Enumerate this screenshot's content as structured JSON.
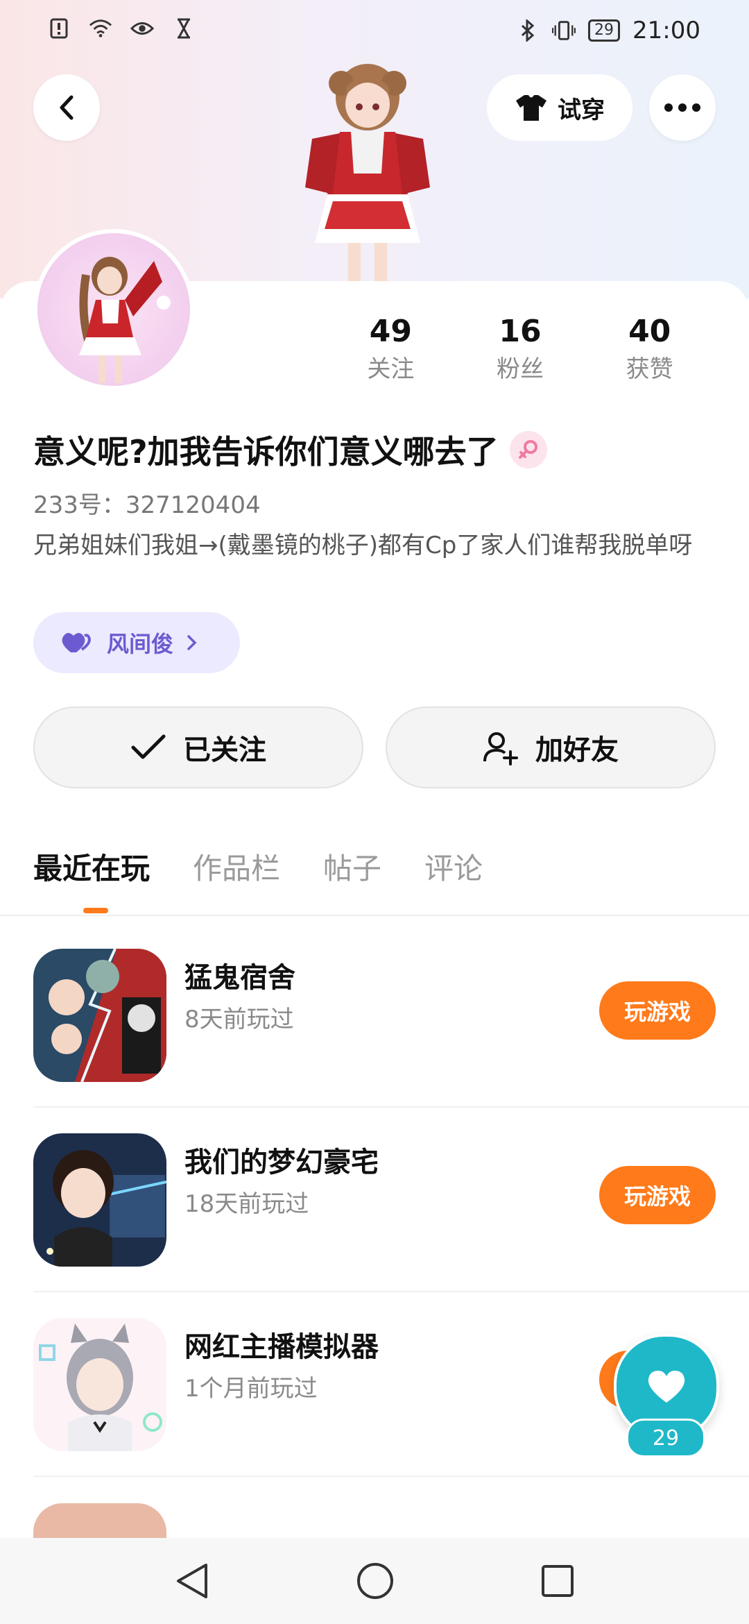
{
  "status_bar": {
    "battery": "29",
    "time": "21:00"
  },
  "header": {
    "back_icon": "chevron-left-icon",
    "try_on_label": "试穿",
    "more_icon": "more-dots-icon"
  },
  "profile": {
    "stats": [
      {
        "value": "49",
        "label": "关注"
      },
      {
        "value": "16",
        "label": "粉丝"
      },
      {
        "value": "40",
        "label": "获赞"
      }
    ],
    "username": "意义呢?加我告诉你们意义哪去了",
    "user_id": "233号：327120404",
    "bio": "兄弟姐妹们我姐→(戴墨镜的桃子)都有Cp了家人们谁帮我脱单呀",
    "relation_tag": "风间俊",
    "colors": {
      "accent": "#ff7a1a",
      "tag_bg": "#eceaff",
      "tag_text": "#6c5bd0",
      "like_button": "#1fb8c8"
    }
  },
  "actions": {
    "followed_label": "已关注",
    "add_friend_label": "加好友"
  },
  "tabs": [
    "最近在玩",
    "作品栏",
    "帖子",
    "评论"
  ],
  "games": [
    {
      "name": "猛鬼宿舍",
      "time": "8天前玩过",
      "button": "玩游戏"
    },
    {
      "name": "我们的梦幻豪宅",
      "time": "18天前玩过",
      "button": "玩游戏"
    },
    {
      "name": "网红主播模拟器",
      "time": "1个月前玩过",
      "button": "玩游戏"
    }
  ],
  "floating_like": {
    "count": "29"
  }
}
